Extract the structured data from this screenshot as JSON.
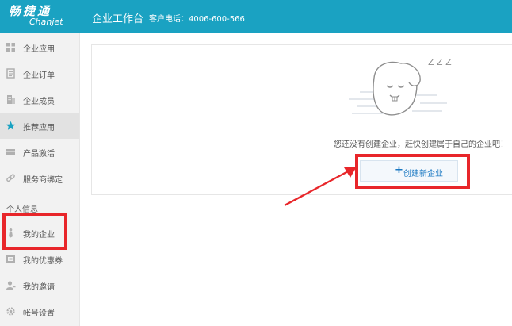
{
  "header": {
    "logo_cn": "畅捷通",
    "logo_en": "Chanjet",
    "app_title": "企业工作台",
    "phone": "客户电话：4006-600-566"
  },
  "sidebar": {
    "items": [
      {
        "label": "企业应用",
        "icon": "grid-icon"
      },
      {
        "label": "企业订单",
        "icon": "order-icon"
      },
      {
        "label": "企业成员",
        "icon": "building-icon"
      },
      {
        "label": "推荐应用",
        "icon": "star-icon",
        "active": true
      },
      {
        "label": "产品激活",
        "icon": "card-icon"
      },
      {
        "label": "服务商绑定",
        "icon": "link-icon"
      }
    ],
    "section_title": "个人信息",
    "personal_items": [
      {
        "label": "我的企业",
        "icon": "tie-icon"
      },
      {
        "label": "我的优惠券",
        "icon": "coupon-icon"
      },
      {
        "label": "我的邀请",
        "icon": "user-icon"
      },
      {
        "label": "帐号设置",
        "icon": "gear-icon"
      }
    ]
  },
  "main": {
    "empty_message": "您还没有创建企业，赶快创建属于自己的企业吧！",
    "create_button": "创建新企业",
    "sleep_text": "Z Z Z"
  },
  "colors": {
    "header": "#1aa2c2",
    "annotation_red": "#e8262a",
    "link_blue": "#1a78c2"
  }
}
